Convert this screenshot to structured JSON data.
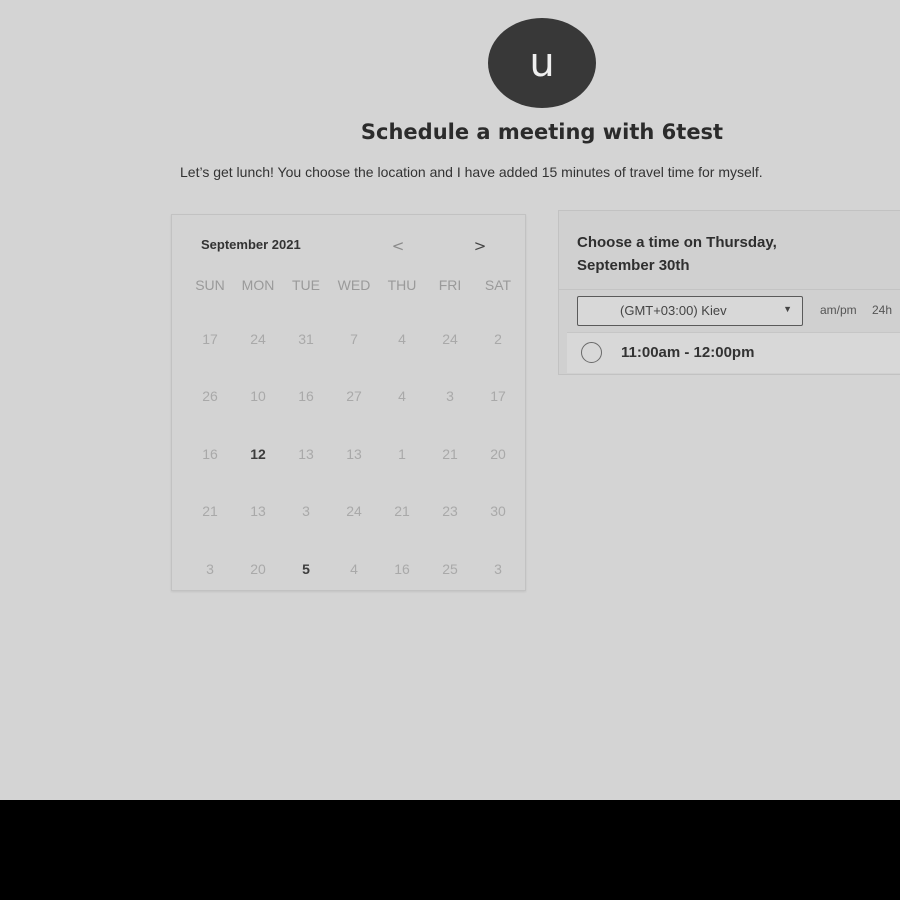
{
  "header": {
    "avatar_letter": "u",
    "title": "Schedule a meeting with 6test",
    "description": "Let’s get lunch! You choose the location and I have added 15 minutes of travel time for myself."
  },
  "calendar": {
    "month_label": "September 2021",
    "prev_icon": "chevron-left-icon",
    "next_icon": "chevron-right-icon",
    "prev_glyph": "<",
    "next_glyph": ">",
    "weekdays": [
      "SUN",
      "MON",
      "TUE",
      "WED",
      "THU",
      "FRI",
      "SAT"
    ],
    "weeks": [
      [
        "17",
        "24",
        "31",
        "7",
        "4",
        "24",
        "2"
      ],
      [
        "26",
        "10",
        "16",
        "27",
        "4",
        "3",
        "17"
      ],
      [
        "16",
        "12",
        "13",
        "13",
        "1",
        "21",
        "20"
      ],
      [
        "21",
        "13",
        "3",
        "24",
        "21",
        "23",
        "30"
      ],
      [
        "3",
        "20",
        "5",
        "4",
        "16",
        "25",
        "3"
      ]
    ],
    "available_days": [
      [
        2,
        1
      ],
      [
        4,
        2
      ]
    ]
  },
  "time_panel": {
    "heading_line1": "Choose a time on Thursday,",
    "heading_line2": "September 30th",
    "timezone": "(GMT+03:00) Kiev",
    "format_ampm": "am/pm",
    "format_24h": "24h",
    "slots": [
      "11:00am - 12:00pm"
    ]
  }
}
